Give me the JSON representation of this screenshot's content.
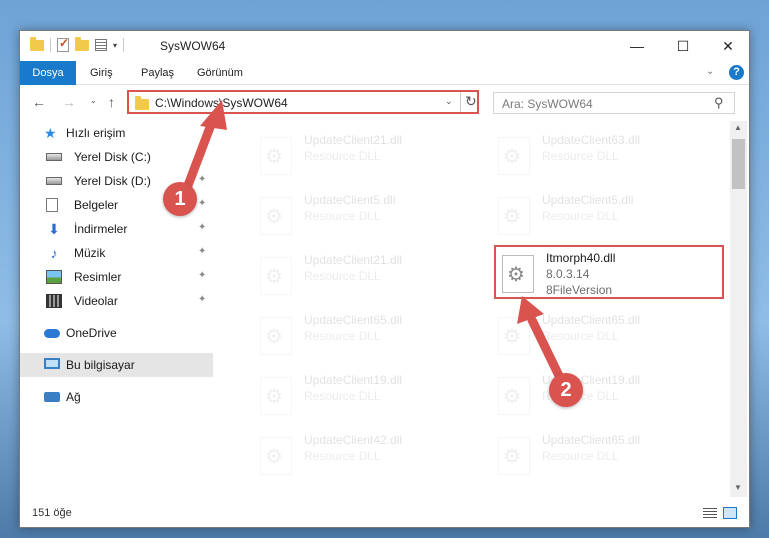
{
  "window": {
    "title": "SysWOW64",
    "minimize_label": "—",
    "maximize_label": "☐",
    "close_label": "✕"
  },
  "ribbon": {
    "tabs": [
      "Dosya",
      "Giriş",
      "Paylaş",
      "Görünüm"
    ],
    "help_label": "?",
    "collapse_label": "⌄"
  },
  "nav": {
    "back": "←",
    "forward": "→",
    "recent": "⌄",
    "up": "↑",
    "address": "C:\\Windows\\SysWOW64",
    "address_dropdown": "⌄",
    "refresh": "↻",
    "search_placeholder": "Ara: SysWOW64",
    "search_icon": "⚲"
  },
  "sidebar": {
    "items": [
      {
        "label": "Hızlı erişim",
        "icon": "star-icon"
      },
      {
        "label": "Yerel Disk (C:)",
        "icon": "drive-icon",
        "pinned": true
      },
      {
        "label": "Yerel Disk (D:)",
        "icon": "drive-icon",
        "pinned": true
      },
      {
        "label": "Belgeler",
        "icon": "document-icon",
        "pinned": true
      },
      {
        "label": "İndirmeler",
        "icon": "download-icon",
        "pinned": true
      },
      {
        "label": "Müzik",
        "icon": "music-icon",
        "pinned": true
      },
      {
        "label": "Resimler",
        "icon": "pictures-icon",
        "pinned": true
      },
      {
        "label": "Videolar",
        "icon": "video-icon",
        "pinned": true
      },
      {
        "label": "OneDrive",
        "icon": "cloud-icon"
      },
      {
        "label": "Bu bilgisayar",
        "icon": "computer-icon",
        "selected": true
      },
      {
        "label": "Ağ",
        "icon": "network-icon"
      }
    ],
    "pin_glyph": "📌"
  },
  "files": [
    {
      "name": "UpdateClient21.dll",
      "line1": "Resource DLL",
      "line2": "",
      "faded": true
    },
    {
      "name": "UpdateClient63.dll",
      "line1": "Resource DLL",
      "line2": "",
      "faded": true
    },
    {
      "name": "UpdateClient5.dll",
      "line1": "Resource DLL",
      "line2": "",
      "faded": true
    },
    {
      "name": "UpdateClient5.dll",
      "line1": "Resource DLL",
      "line2": "",
      "faded": true
    },
    {
      "name": "UpdateClient21.dll",
      "line1": "Resource DLL",
      "line2": "",
      "faded": true
    },
    {
      "name": "Itmorph40.dll",
      "line1": "8.0.3.14",
      "line2": "8FileVersion",
      "faded": false
    },
    {
      "name": "UpdateClient65.dll",
      "line1": "Resource DLL",
      "line2": "",
      "faded": true
    },
    {
      "name": "UpdateClient65.dll",
      "line1": "Resource DLL",
      "line2": "",
      "faded": true
    },
    {
      "name": "UpdateClient19.dll",
      "line1": "Resource DLL",
      "line2": "",
      "faded": true
    },
    {
      "name": "UpdateClient19.dll",
      "line1": "Resource DLL",
      "line2": "",
      "faded": true
    },
    {
      "name": "UpdateClient42.dll",
      "line1": "Resource DLL",
      "line2": "",
      "faded": true
    },
    {
      "name": "UpdateClient65.dll",
      "line1": "Resource DLL",
      "line2": "",
      "faded": true
    }
  ],
  "status": {
    "item_count": "151 öğe"
  },
  "annotations": {
    "marker1": "1",
    "marker2": "2",
    "color": "#d9534f"
  }
}
